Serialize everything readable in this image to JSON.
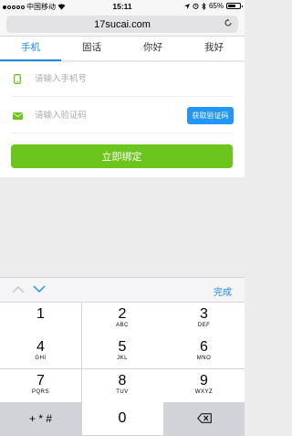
{
  "status_bar": {
    "carrier": "中国移动",
    "time": "15:11",
    "battery": "65%",
    "battery_level": 0.65
  },
  "browser": {
    "url": "17sucai.com"
  },
  "tabs": [
    {
      "label": "手机",
      "active": true
    },
    {
      "label": "固话",
      "active": false
    },
    {
      "label": "你好",
      "active": false
    },
    {
      "label": "我好",
      "active": false
    }
  ],
  "form": {
    "phone_placeholder": "请输入手机号",
    "code_placeholder": "请输入验证码",
    "get_code_label": "获取验证码",
    "bind_label": "立即绑定"
  },
  "accessory": {
    "done_label": "完成"
  },
  "keypad": {
    "keys": [
      {
        "num": "1",
        "letters": ""
      },
      {
        "num": "2",
        "letters": "ABC"
      },
      {
        "num": "3",
        "letters": "DEF"
      },
      {
        "num": "4",
        "letters": "GHI"
      },
      {
        "num": "5",
        "letters": "JKL"
      },
      {
        "num": "6",
        "letters": "MNO"
      },
      {
        "num": "7",
        "letters": "PQRS"
      },
      {
        "num": "8",
        "letters": "TUV"
      },
      {
        "num": "9",
        "letters": "WXYZ"
      },
      {
        "num": "0",
        "letters": ""
      }
    ],
    "symbols_label": "+ * #"
  },
  "colors": {
    "accent": "#1e88e5",
    "button_blue": "#2196f3",
    "bind_green": "#6cc51c",
    "icon_green": "#6cc51c"
  }
}
